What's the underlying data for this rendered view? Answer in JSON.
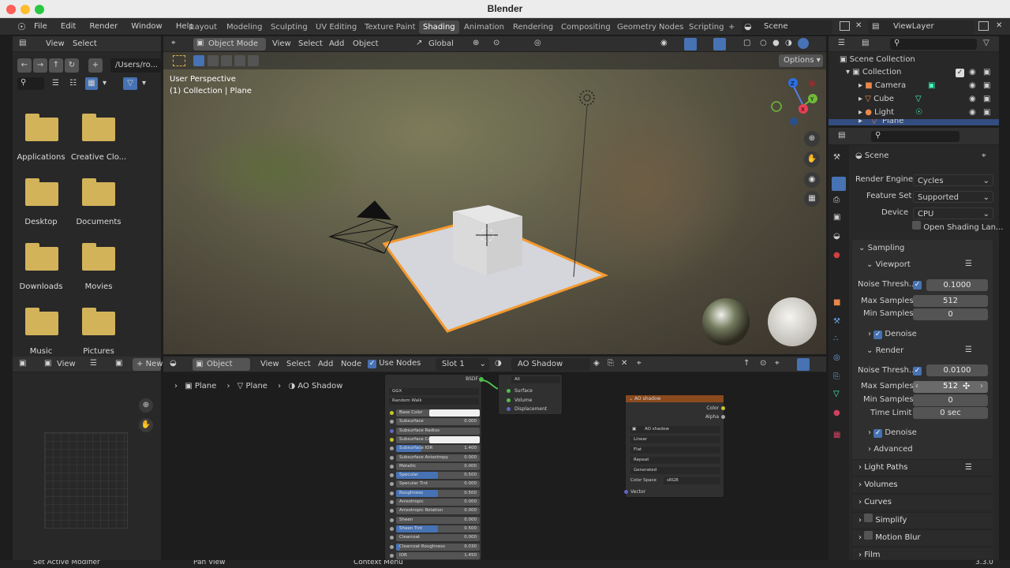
{
  "window": {
    "title": "Blender",
    "version": "3.3.0"
  },
  "menubar": {
    "items": [
      "File",
      "Edit",
      "Render",
      "Window",
      "Help"
    ]
  },
  "workspaces": {
    "tabs": [
      "Layout",
      "Modeling",
      "Sculpting",
      "UV Editing",
      "Texture Paint",
      "Shading",
      "Animation",
      "Rendering",
      "Compositing",
      "Geometry Nodes",
      "Scripting"
    ],
    "active": "Shading",
    "plus": "+"
  },
  "scene": {
    "name": "Scene",
    "view_layer": "ViewLayer"
  },
  "file_browser": {
    "menus": [
      "View",
      "Select"
    ],
    "path": "/Users/ro...",
    "folders": [
      "Applications",
      "Creative Clo...",
      "Desktop",
      "Documents",
      "Downloads",
      "Movies",
      "Music",
      "Pictures"
    ]
  },
  "viewport": {
    "mode": "Object Mode",
    "menus": [
      "View",
      "Select",
      "Add",
      "Object"
    ],
    "transform": "Global",
    "options": "Options",
    "overlay_line1": "User Perspective",
    "overlay_line2": "(1) Collection | Plane",
    "axes": [
      "Z",
      "Y",
      "X"
    ]
  },
  "outliner": {
    "root": "Scene Collection",
    "collection": "Collection",
    "items": [
      "Camera",
      "Cube",
      "Light",
      "Plane"
    ]
  },
  "properties": {
    "context": "Scene",
    "render_engine_label": "Render Engine",
    "render_engine": "Cycles",
    "feature_set_label": "Feature Set",
    "feature_set": "Supported",
    "device_label": "Device",
    "device": "CPU",
    "open_shading": "Open Shading Lan...",
    "sampling": "Sampling",
    "viewport": "Viewport",
    "noise_label": "Noise Thresh...",
    "vp_noise": "0.1000",
    "max_samples_label": "Max Samples",
    "vp_max": "512",
    "min_samples_label": "Min Samples",
    "vp_min": "0",
    "denoise": "Denoise",
    "render": "Render",
    "r_noise": "0.0100",
    "r_max": "512",
    "r_min": "0",
    "time_limit_label": "Time Limit",
    "r_time": "0 sec",
    "advanced": "Advanced",
    "sections": [
      "Light Paths",
      "Volumes",
      "Curves",
      "Simplify",
      "Motion Blur",
      "Film"
    ]
  },
  "image_editor": {
    "view": "View",
    "new": "New"
  },
  "node_editor": {
    "editor_type": "Object",
    "menus": [
      "View",
      "Select",
      "Add",
      "Node"
    ],
    "use_nodes": "Use Nodes",
    "slot": "Slot 1",
    "material": "AO Shadow",
    "breadcrumb": [
      "Plane",
      "Plane",
      "AO Shadow"
    ]
  },
  "bsdf_node": {
    "output": "BSDF",
    "distribution": "GGX",
    "subsurface_method": "Random Walk",
    "rows": [
      {
        "label": "Base Color",
        "value": ""
      },
      {
        "label": "Subsurface",
        "value": "0.000"
      },
      {
        "label": "Subsurface Radius",
        "value": ""
      },
      {
        "label": "Subsurface Colo",
        "value": ""
      },
      {
        "label": "Subsurface IOR",
        "value": "1.400"
      },
      {
        "label": "Subsurface Anisotropy",
        "value": "0.000"
      },
      {
        "label": "Metallic",
        "value": "0.000"
      },
      {
        "label": "Specular",
        "value": "0.500"
      },
      {
        "label": "Specular Tint",
        "value": "0.000"
      },
      {
        "label": "Roughness",
        "value": "0.500"
      },
      {
        "label": "Anisotropic",
        "value": "0.000"
      },
      {
        "label": "Anisotropic Rotation",
        "value": "0.000"
      },
      {
        "label": "Sheen",
        "value": "0.000"
      },
      {
        "label": "Sheen Tint",
        "value": "0.500"
      },
      {
        "label": "Clearcoat",
        "value": "0.000"
      },
      {
        "label": "Clearcoat Roughness",
        "value": "0.030"
      },
      {
        "label": "IOR",
        "value": "1.450"
      }
    ]
  },
  "output_node": {
    "target": "All",
    "inputs": [
      "Surface",
      "Volume",
      "Displacement"
    ]
  },
  "texture_node": {
    "title": "AO shadow",
    "outputs": [
      "Color",
      "Alpha"
    ],
    "image": "AO shadow",
    "interp": "Linear",
    "proj": "Flat",
    "ext": "Repeat",
    "source": "Generated",
    "colorspace_label": "Color Space",
    "colorspace": "sRGB",
    "vector": "Vector"
  },
  "statusbar": {
    "items": [
      "Set Active Modifier",
      "Pan View",
      "Context Menu"
    ],
    "version": "3.3.0"
  },
  "colors": {
    "accent": "#4772b3",
    "selection": "#f49a30",
    "node_header": "#8a4a1e"
  }
}
